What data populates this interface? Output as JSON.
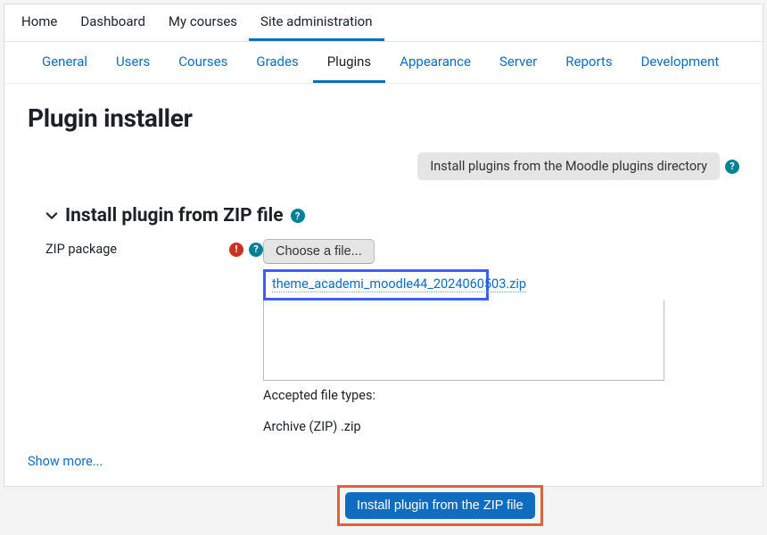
{
  "topnav": {
    "items": [
      {
        "label": "Home"
      },
      {
        "label": "Dashboard"
      },
      {
        "label": "My courses"
      },
      {
        "label": "Site administration"
      }
    ],
    "activeIndex": 3
  },
  "subtabs": {
    "items": [
      {
        "label": "General"
      },
      {
        "label": "Users"
      },
      {
        "label": "Courses"
      },
      {
        "label": "Grades"
      },
      {
        "label": "Plugins"
      },
      {
        "label": "Appearance"
      },
      {
        "label": "Server"
      },
      {
        "label": "Reports"
      },
      {
        "label": "Development"
      }
    ],
    "activeIndex": 4
  },
  "page": {
    "title": "Plugin installer",
    "directory_button": "Install plugins from the Moodle plugins directory",
    "section_title": "Install plugin from ZIP file",
    "zip_label": "ZIP package",
    "choose_file_label": "Choose a file...",
    "selected_file": "theme_academi_moodle44_2024060503.zip",
    "accepted_types_label": "Accepted file types:",
    "archive_label": "Archive (ZIP) .zip",
    "show_more": "Show more...",
    "submit_label": "Install plugin from the ZIP file"
  },
  "icons": {
    "help_glyph": "?",
    "required_glyph": "!"
  },
  "colors": {
    "link": "#0f6cbf",
    "accent_active": "#0f6cbf",
    "highlight_blue": "#3d5cff",
    "highlight_orange": "#e0613e",
    "help_bg": "#008196",
    "required_bg": "#ca3120"
  }
}
